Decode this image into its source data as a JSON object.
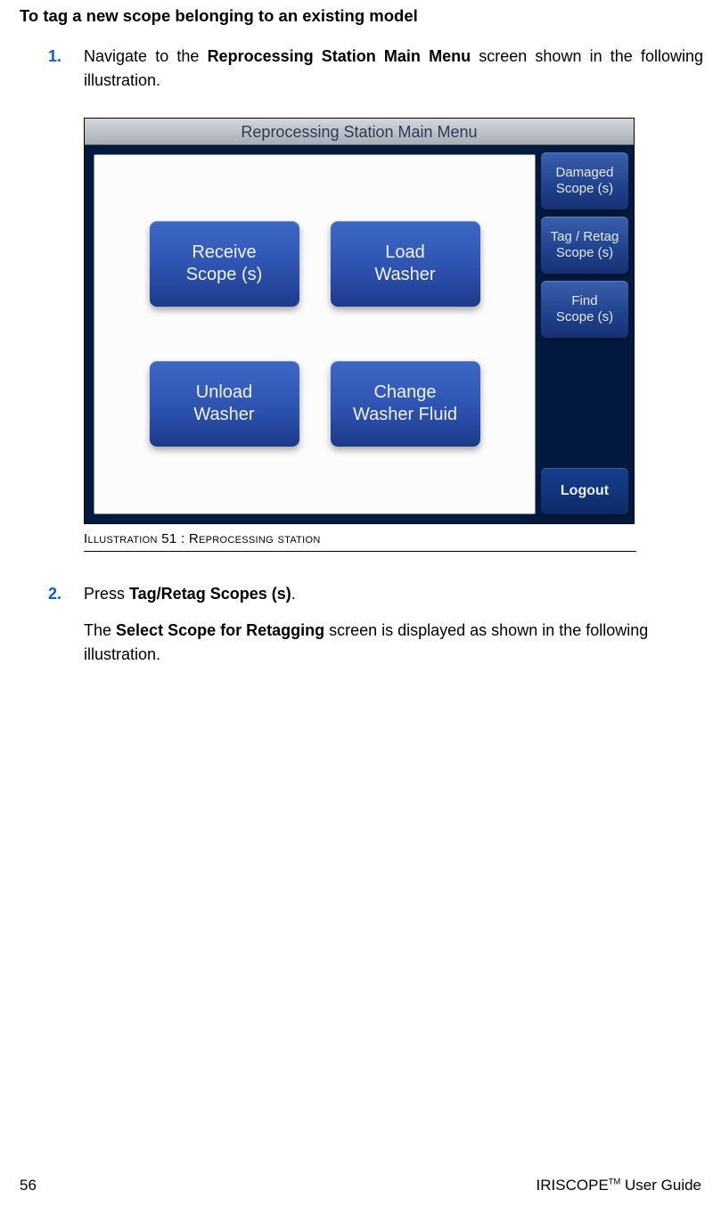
{
  "heading": "To tag a new scope belonging to an existing model",
  "steps": {
    "s1": {
      "num": "1.",
      "pre": "Navigate to the ",
      "bold": "Reprocessing Station Main Menu",
      "post": " screen shown in the following illustration."
    },
    "s2": {
      "num": "2.",
      "pre": "Press ",
      "bold": "Tag/Retag Scopes (s)",
      "post": ".",
      "after_pre": "The ",
      "after_bold": "Select Scope for Retagging",
      "after_post": " screen is displayed as shown in the following illustration."
    }
  },
  "screenshot": {
    "title": "Reprocessing Station Main Menu",
    "main_buttons": {
      "receive": "Receive\nScope (s)",
      "load": "Load\nWasher",
      "unload": "Unload\nWasher",
      "change": "Change\nWasher Fluid"
    },
    "side_buttons": {
      "damaged": "Damaged\nScope (s)",
      "tag": "Tag / Retag\nScope (s)",
      "find": "Find\nScope (s)"
    },
    "logout": "Logout"
  },
  "caption": "Illustration 51 : Reprocessing station",
  "footer": {
    "page": "56",
    "doc_pre": "IRISCOPE",
    "doc_tm": "TM",
    "doc_post": " User Guide"
  }
}
